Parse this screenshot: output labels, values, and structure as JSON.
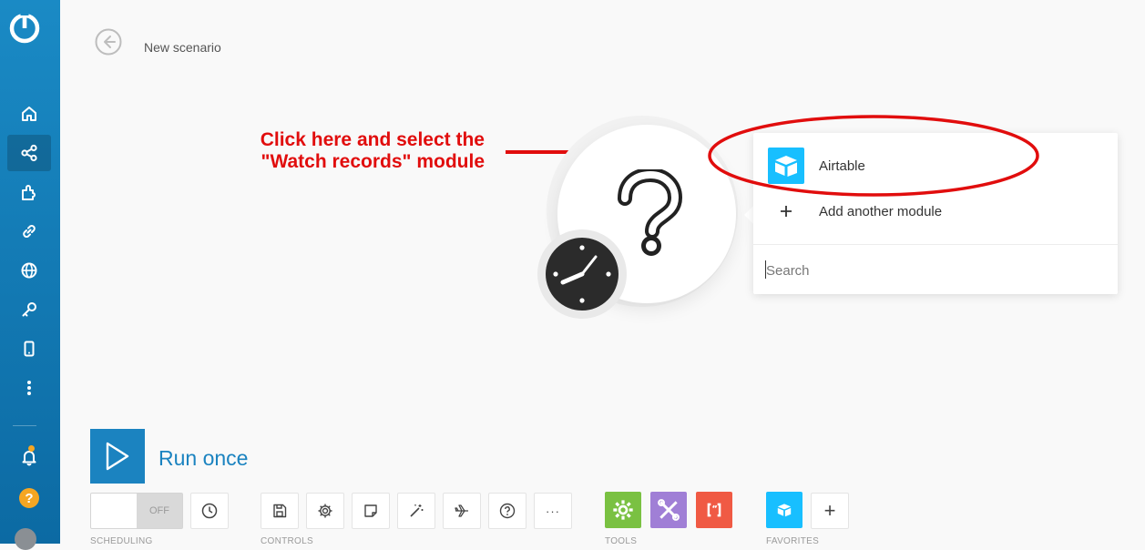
{
  "header": {
    "breadcrumb": "New scenario"
  },
  "annotation": {
    "line1": "Click here and select the",
    "line2": "\"Watch records\" module"
  },
  "dropdown": {
    "items": [
      {
        "label": "Airtable",
        "icon": "airtable-icon"
      },
      {
        "label": "Add another module",
        "icon": "plus-icon"
      }
    ],
    "search_placeholder": "Search"
  },
  "run": {
    "label": "Run once"
  },
  "scheduling": {
    "toggle_state": "OFF",
    "label": "SCHEDULING"
  },
  "controls": {
    "label": "CONTROLS"
  },
  "tools": {
    "label": "TOOLS",
    "colors": [
      "#7ac142",
      "#a07fd6",
      "#f05a44"
    ]
  },
  "favorites": {
    "label": "FAVORITES",
    "add_label": "+"
  },
  "help": {
    "label": "?"
  },
  "toolbar": {
    "more_label": "···"
  },
  "colors": {
    "sidebar": "#1a8ac5",
    "accent": "#1b83c0",
    "annotation": "#e10d0d",
    "airtable": "#18bfff"
  }
}
